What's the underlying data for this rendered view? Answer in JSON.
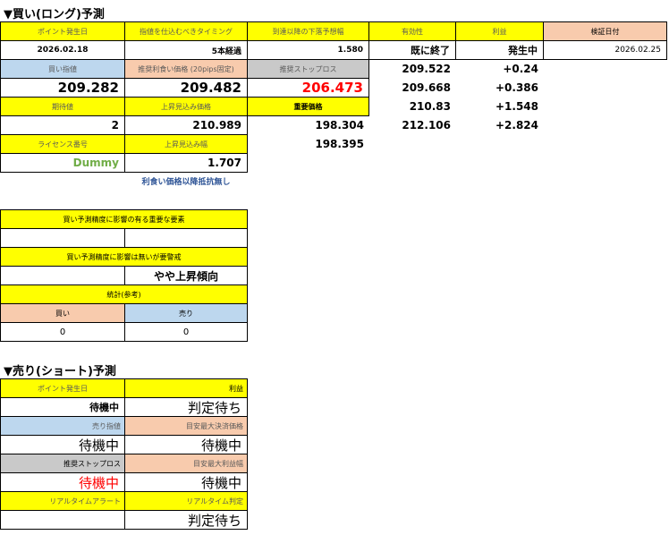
{
  "long": {
    "title": "▼買い(ロング)予測",
    "hdr_point_date": "ポイント発生日",
    "hdr_order_timing": "指値を仕込むべきタイミング",
    "hdr_drop_forecast": "到達以降の下落予想幅",
    "hdr_validity": "有効性",
    "hdr_profit": "利益",
    "hdr_verify_date": "検証日付",
    "point_date": "2026.02.18",
    "order_timing": "5本経過",
    "drop_forecast": "1.580",
    "validity": "既に終了",
    "profit_status": "発生中",
    "verify_date": "2026.02.25",
    "hdr_buy_limit": "買い指値",
    "hdr_recommended_tp": "推奨利食い価格 (20pips固定)",
    "hdr_recommended_sl": "推奨ストップロス",
    "buy_limit": "209.282",
    "recommended_tp": "209.482",
    "recommended_sl": "206.473",
    "hdr_expected_value": "期待値",
    "hdr_upside_price": "上昇見込み価格",
    "hdr_important_price": "重要価格",
    "expected_value": "2",
    "upside_price": "210.989",
    "important_price_1": "198.304",
    "important_price_2": "198.395",
    "hdr_license": "ライセンス番号",
    "hdr_upside_width": "上昇見込み幅",
    "license": "Dummy",
    "upside_width": "1.707",
    "note": "利食い価格以降抵抗無し",
    "levels": [
      {
        "price": "209.522",
        "profit": "+0.24"
      },
      {
        "price": "209.668",
        "profit": "+0.386"
      },
      {
        "price": "210.83",
        "profit": "+1.548"
      },
      {
        "price": "212.106",
        "profit": "+2.824"
      }
    ]
  },
  "factors": {
    "hdr_influential": "買い予測精度に影響の有る重要な要素",
    "hdr_non_influential": "買い予測精度に影響は無いが要警戒",
    "trend_text": "やや上昇傾向",
    "hdr_stats": "統計(参考)",
    "hdr_buy": "買い",
    "hdr_sell": "売り",
    "buy_count": "0",
    "sell_count": "0"
  },
  "short": {
    "title": "▼売り(ショート)予測",
    "hdr_point_date": "ポイント発生日",
    "hdr_profit": "利益",
    "point_date": "待機中",
    "profit": "判定待ち",
    "hdr_sell_limit": "売り指値",
    "hdr_tp_guide": "目安最大決済価格",
    "sell_limit": "待機中",
    "tp_guide": "待機中",
    "hdr_sl": "推奨ストップロス",
    "hdr_max_profit": "目安最大利益幅",
    "sl": "待機中",
    "max_profit": "待機中",
    "hdr_alert": "リアルタイムアラート",
    "hdr_realtime": "リアルタイム判定",
    "alert": "",
    "realtime": "判定待ち"
  },
  "colors": {
    "yellow": "#ffff00",
    "blue": "#bdd7ee",
    "peach": "#f8cbad",
    "gray": "#c9c9c9",
    "red": "#ff0000",
    "green": "#70ad47",
    "note_blue": "#2f5597"
  }
}
